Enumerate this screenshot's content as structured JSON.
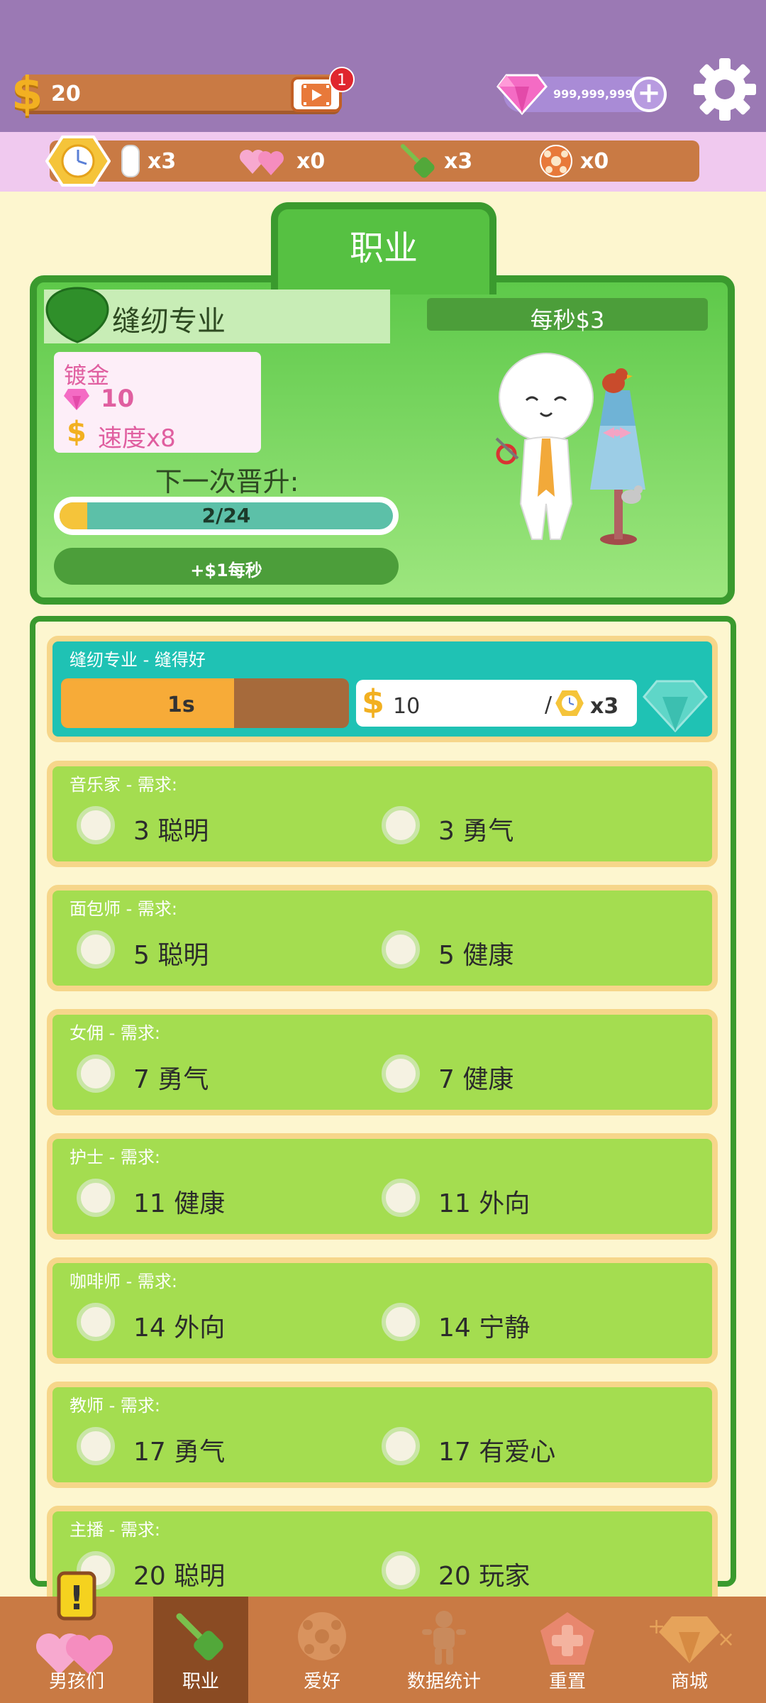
{
  "status": {
    "money": "20",
    "video_badge": "1",
    "gems": "999,999,999",
    "plus": "+"
  },
  "items": [
    {
      "name": "time-skip-icon",
      "count": "x3"
    },
    {
      "name": "hearts-icon",
      "count": "x0"
    },
    {
      "name": "shovel-icon",
      "count": "x3"
    },
    {
      "name": "ball-icon",
      "count": "x0"
    }
  ],
  "job_card": {
    "tab_title": "职业",
    "job_name": "缝纫专业",
    "per_second": "每秒$3",
    "gild_title": "镀金",
    "gild_gems": "10",
    "gild_coin": "$",
    "gild_speed": "速度x8",
    "promotion_label": "下一次晋升:",
    "progress_text": "2/24",
    "progress_fraction": 0.083,
    "bonus_text": "+$1每秒"
  },
  "current_job": {
    "title": "缝纫专业 - 缝得好",
    "timer": "1s",
    "timer_fraction": 0.6,
    "earn_coin": "$",
    "earn_value": "10",
    "slash": "/",
    "multiplier": "x3"
  },
  "requirements": [
    {
      "title": "音乐家 - 需求:",
      "a": "3 聪明",
      "b": "3 勇气"
    },
    {
      "title": "面包师 - 需求:",
      "a": "5 聪明",
      "b": "5 健康"
    },
    {
      "title": "女佣 - 需求:",
      "a": "7 勇气",
      "b": "7 健康"
    },
    {
      "title": "护士 - 需求:",
      "a": "11 健康",
      "b": "11 外向"
    },
    {
      "title": "咖啡师 - 需求:",
      "a": "14 外向",
      "b": "14 宁静"
    },
    {
      "title": "教师 - 需求:",
      "a": "17 勇气",
      "b": "17 有爱心"
    },
    {
      "title": "主播 - 需求:",
      "a": "20 聪明",
      "b": "20 玩家"
    }
  ],
  "nav": {
    "boys": "男孩们",
    "job": "职业",
    "hobby": "爱好",
    "stats": "数据统计",
    "reset": "重置",
    "shop": "商城",
    "alert": "!"
  },
  "colors": {
    "top_bar": "#9b79b4",
    "green_accent": "#56c142",
    "teal_current": "#1fc2b4",
    "nav_bg": "#c97a44"
  }
}
